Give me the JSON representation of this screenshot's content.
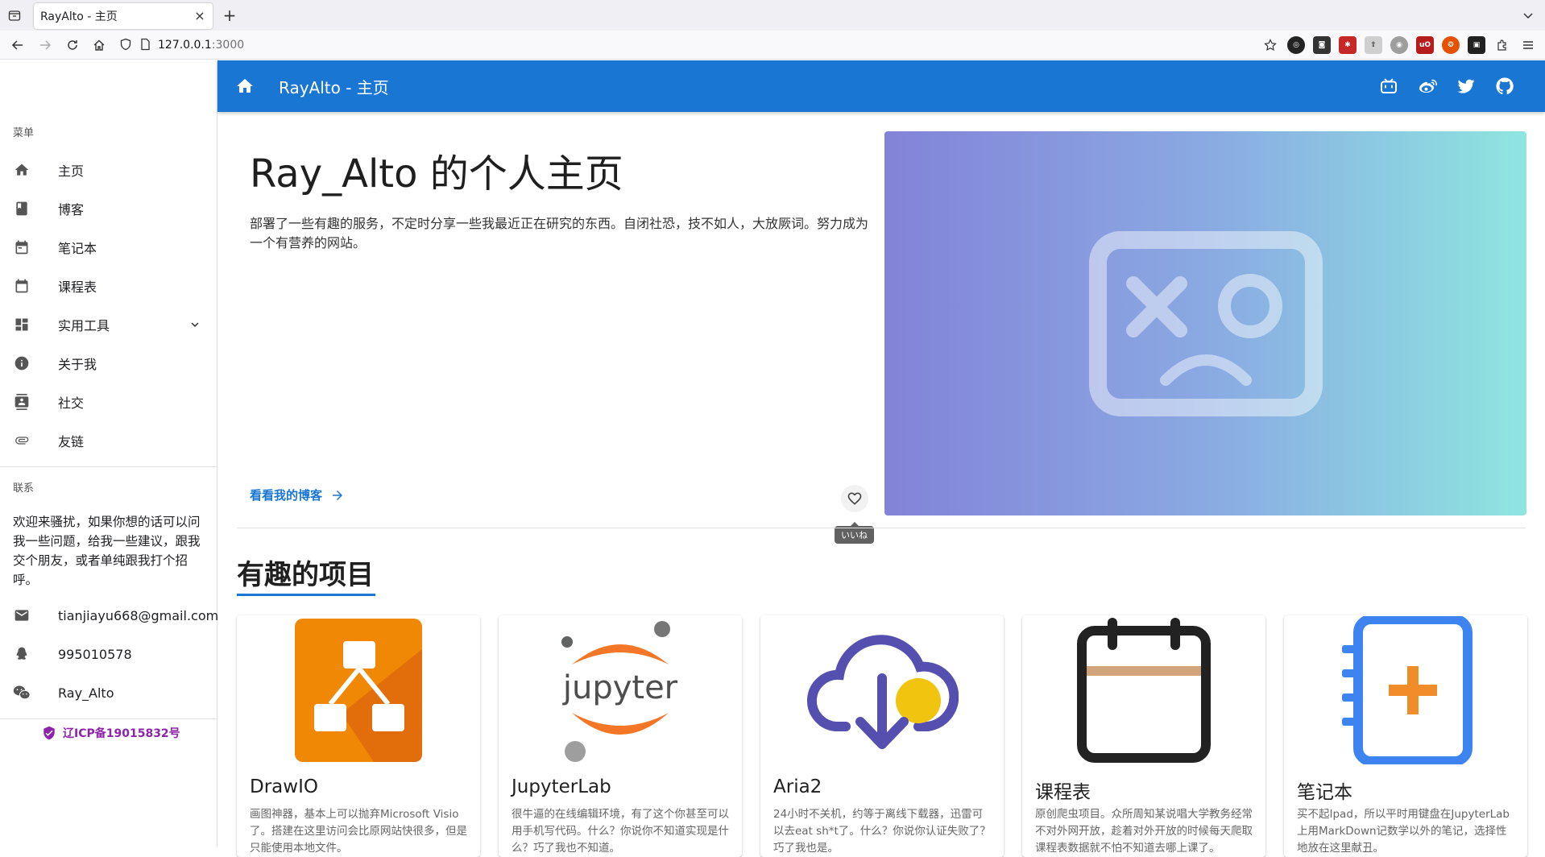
{
  "browser": {
    "tab_title": "RayAlto - 主页",
    "url_host": "127.0.0.1",
    "url_port": ":3000"
  },
  "sidebar": {
    "menu_header": "菜单",
    "items": [
      {
        "label": "主页",
        "icon": "home-icon"
      },
      {
        "label": "博客",
        "icon": "book-icon"
      },
      {
        "label": "笔记本",
        "icon": "notebook-icon"
      },
      {
        "label": "课程表",
        "icon": "calendar-icon"
      },
      {
        "label": "实用工具",
        "icon": "dashboard-icon"
      },
      {
        "label": "关于我",
        "icon": "info-icon"
      },
      {
        "label": "社交",
        "icon": "contacts-icon"
      },
      {
        "label": "友链",
        "icon": "link-icon"
      }
    ],
    "contact_header": "联系",
    "contact_text": "欢迎来骚扰，如果你想的话可以问我一些问题，给我一些建议，跟我交个朋友，或者单纯跟我打个招呼。",
    "contacts": [
      {
        "label": "tianjiayu668@gmail.com",
        "icon": "mail-icon"
      },
      {
        "label": "995010578",
        "icon": "qq-icon"
      },
      {
        "label": "Ray_Alto",
        "icon": "wechat-icon"
      }
    ],
    "icp": "辽ICP备19015832号"
  },
  "appbar": {
    "title": "RayAlto - 主页"
  },
  "hero": {
    "title": "Ray_Alto 的个人主页",
    "description": "部署了一些有趣的服务，不定时分享一些我最近正在研究的东西。自闭社恐，技不如人，大放厥词。努力成为一个有营养的网站。",
    "link_label": "看看我的博客",
    "like_tooltip": "いいね"
  },
  "projects": {
    "heading": "有趣的项目",
    "cards": [
      {
        "title": "DrawIO",
        "description": "画图神器，基本上可以抛弃Microsoft Visio了。搭建在这里访问会比原网站快很多，但是只能使用本地文件。"
      },
      {
        "title": "JupyterLab",
        "description": "很牛逼的在线编辑环境，有了这个你甚至可以用手机写代码。什么？你说你不知道实现是什么？巧了我也不知道。"
      },
      {
        "title": "Aria2",
        "description": "24小时不关机，约等于离线下载器，迅雷可以去eat sh*t了。什么？你说你认证失败了？巧了我也是。"
      },
      {
        "title": "课程表",
        "description": "原创爬虫项目。众所周知某说唱大学教务经常不对外网开放，趁着对外开放的时候每天爬取课程表数据就不怕不知道去哪上课了。"
      },
      {
        "title": "笔记本",
        "description": "买不起Ipad，所以平时用键盘在JupyterLab上用MarkDown记数学以外的笔记，选择性地放在这里献丑。"
      }
    ]
  },
  "colors": {
    "primary": "#1976d2",
    "icp": "#8e24aa"
  }
}
